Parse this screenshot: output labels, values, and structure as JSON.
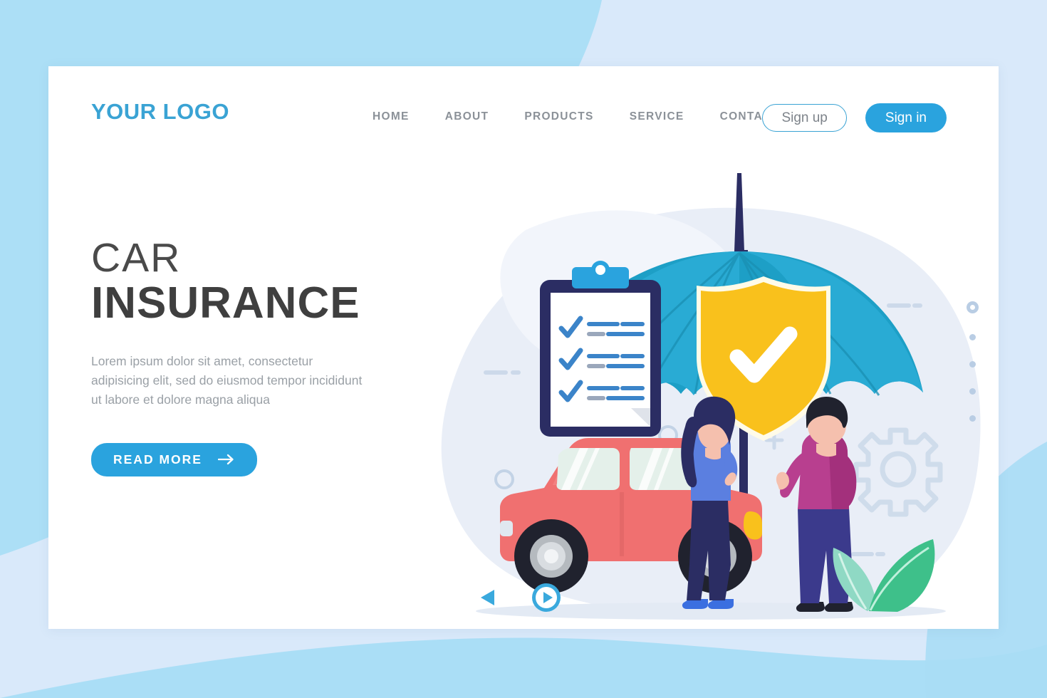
{
  "brand": {
    "logo_text": "YOUR LOGO",
    "logo_color": "#3aa3d4"
  },
  "nav": {
    "items": [
      {
        "label": "HOME"
      },
      {
        "label": "ABOUT"
      },
      {
        "label": "PRODUCTS"
      },
      {
        "label": "SERVICE"
      },
      {
        "label": "CONTACT"
      }
    ]
  },
  "auth": {
    "sign_up_label": "Sign up",
    "sign_in_label": "Sign in",
    "sign_in_bg": "#2aa3de",
    "sign_up_border": "#3aa3d4"
  },
  "hero": {
    "title_line1": "CAR",
    "title_line2": "INSURANCE",
    "paragraph": "Lorem ipsum dolor sit amet, consectetur adipisicing elit, sed do eiusmod tempor incididunt ut labore et dolore magna aliqua",
    "cta_label": "READ MORE",
    "cta_icon": "arrow-right-icon",
    "cta_bg": "#2aa3de"
  },
  "illustration": {
    "name": "car-insurance-illustration",
    "elements": [
      "umbrella",
      "shield-check",
      "clipboard-checklist",
      "red-car",
      "woman-character",
      "man-character",
      "leaves",
      "gear-icon",
      "plus-decor",
      "circle-decor",
      "dash-decor"
    ],
    "colors": {
      "umbrella": "#29abd4",
      "umbrella_dark": "#1a8fb3",
      "pole": "#2b2d63",
      "shield": "#f9c11c",
      "shield_check": "#ffffff",
      "car_body": "#f07070",
      "car_window": "#e4f0ea",
      "woman_top": "#5b7fe0",
      "man_top": "#b83f8f",
      "man_pants": "#3b3a8c",
      "leaf_front": "#3ec08a",
      "leaf_back": "#8fd9c4",
      "blob": "#e8eef7",
      "decor": "#c3d3e6"
    }
  },
  "carousel": {
    "prev_icon": "triangle-left-icon",
    "next_icon": "play-circle-icon",
    "accent": "#3aa9dd"
  },
  "pagination": {
    "dot_count": 5,
    "active_index": 0,
    "dot_color": "#b9cde4"
  },
  "background": {
    "outer": "#d9e9fa",
    "wedge": "#a8ddf5",
    "card": "#ffffff"
  }
}
